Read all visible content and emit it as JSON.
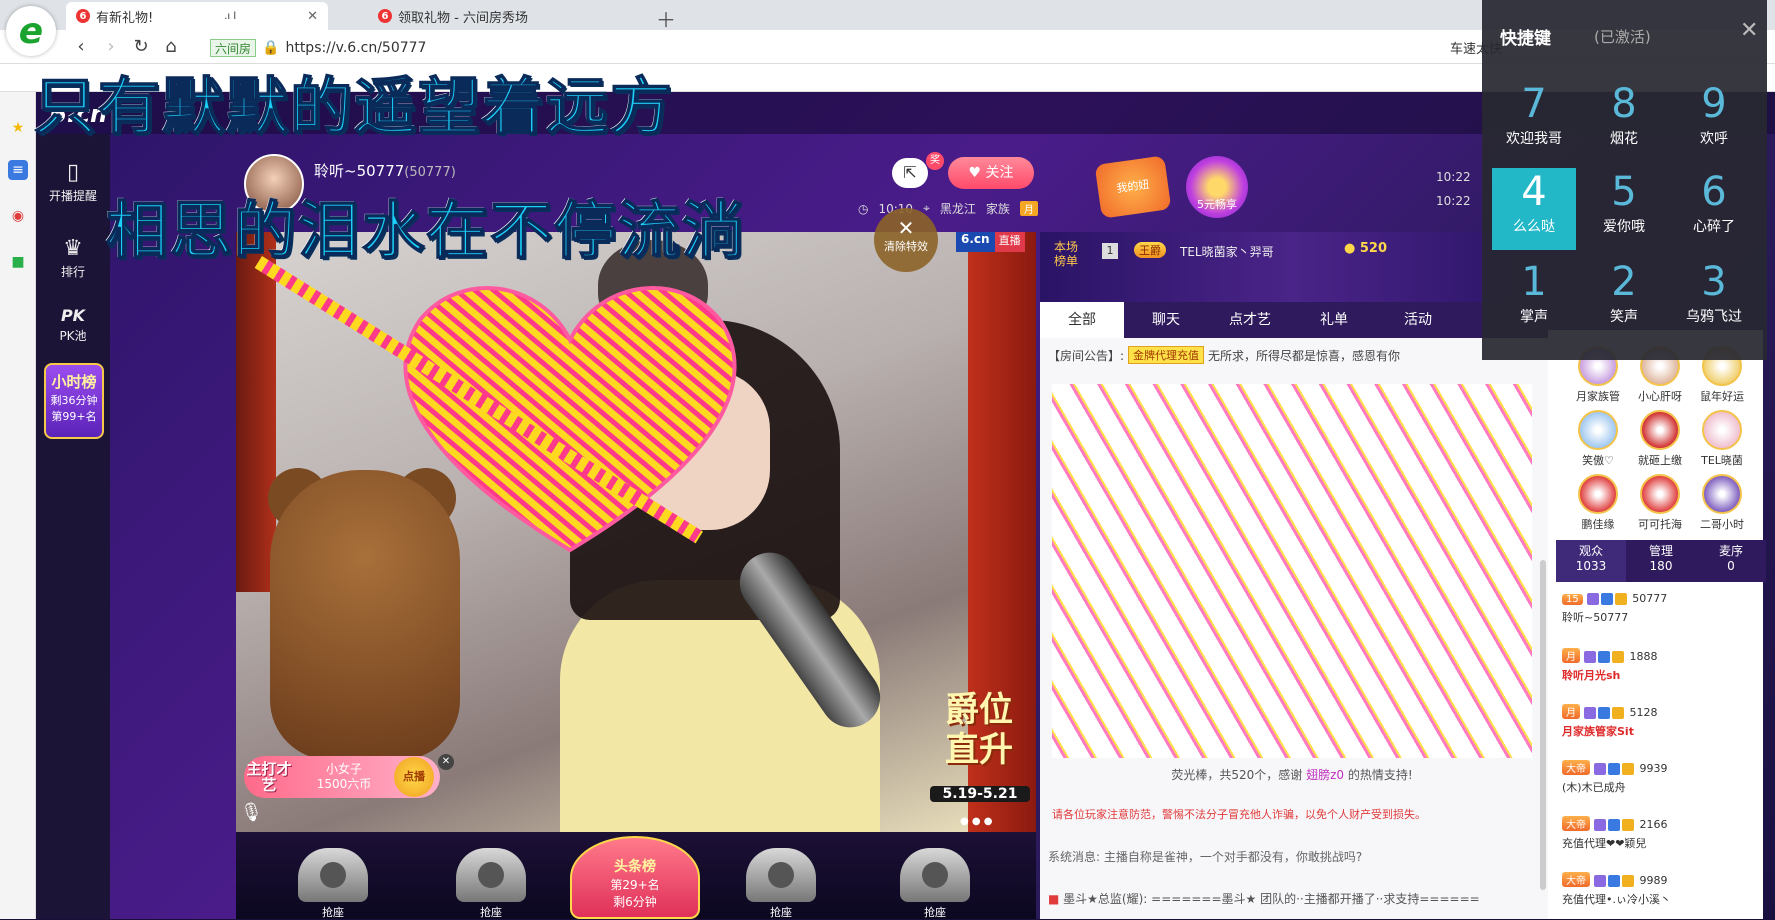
{
  "browser": {
    "tabs": [
      {
        "label": "有新礼物!",
        "status": ".ı l",
        "active": true
      },
      {
        "label": "领取礼物 - 六间房秀场",
        "active": false
      }
    ],
    "site_badge": "六间房",
    "url": "https://v.6.cn/50777",
    "tray_text": "车速太快"
  },
  "site": {
    "logo": "6.cn"
  },
  "left_rail": {
    "items": [
      {
        "label": "开播提醒",
        "icon": "phone-icon"
      },
      {
        "label": "排行",
        "icon": "crown-icon"
      },
      {
        "label": "PK池",
        "icon": "pk-icon"
      }
    ],
    "hourly": {
      "title": "小时榜",
      "remain": "剩36分钟",
      "rank": "第99+名"
    }
  },
  "room": {
    "anchor_name": "聆听~50777",
    "room_id": "(50777)",
    "share_count": "奖",
    "follow_label": "关注",
    "time": "10:10",
    "location": "黑龙江",
    "family_label": "家族",
    "family_badge": "月",
    "my_badge": "我的妞",
    "pay_badge": "5元畅享",
    "time_right_1": "10:22",
    "time_right_2": "10:22"
  },
  "lyrics": {
    "line1": "只有默默的遥望着远方",
    "line2": "相思的泪水在不停流淌"
  },
  "video": {
    "clear_label": "清除特效",
    "live_brand": "6.cn",
    "live_status": "直播",
    "promo_line1": "爵位",
    "promo_line2": "直升",
    "promo_date": "5.19-5.21",
    "feature_tag": "主打才艺",
    "feature_title": "小女子",
    "feature_price": "1500六币",
    "feature_btn": "点播"
  },
  "seats": [
    {
      "label": "抢座"
    },
    {
      "label": "抢座"
    },
    {
      "label": "抢座"
    },
    {
      "label": "抢座"
    }
  ],
  "rank_seat": {
    "title": "头条榜",
    "rank": "第29+名",
    "remain": "剩6分钟"
  },
  "chat": {
    "rank_label": "本场榜单",
    "rank_num": "1",
    "rank_tier": "王爵",
    "rank_user": "TEL晓菌家丶羿哥",
    "rank_coin": "520",
    "tabs": [
      "全部",
      "聊天",
      "点才艺",
      "礼单",
      "活动"
    ],
    "announce_prefix": "【房间公告】:",
    "announce_badge": "金牌代理充值",
    "announce_text": "无所求，所得尽都是惊喜，感恩有你",
    "gift_thanks_prefix": "荧光棒，共520个，感谢",
    "gift_thanks_user": "翅膀z0",
    "gift_thanks_suffix": "的热情支持!",
    "warning": "请各位玩家注意防范，警惕不法分子冒充他人诈骗，以免个人财产受到损失。",
    "system_prefix": "系统消息: 主播自称是雀神，一个对手都没有，你敢挑战吗?",
    "last_msg": "墨斗★总监(耀): =======墨斗★ 团队的··主播都开播了··求支持======"
  },
  "fans": [
    {
      "name": "月家族管",
      "color": "#c8a0e0"
    },
    {
      "name": "小心肝呀",
      "color": "#e0b8a0"
    },
    {
      "name": "鼠年好运",
      "color": "#f0d070"
    },
    {
      "name": "笑傲♡",
      "color": "#a0c8f0"
    },
    {
      "name": "就砸上缴",
      "color": "#d03030"
    },
    {
      "name": "TEL晓菌",
      "color": "#f0c0d0"
    },
    {
      "name": "鹏佳缘",
      "color": "#e04040"
    },
    {
      "name": "可可托海",
      "color": "#e04040"
    },
    {
      "name": "二哥小时",
      "color": "#8060c0"
    }
  ],
  "audience_tabs": [
    {
      "label": "观众",
      "count": "1033"
    },
    {
      "label": "管理",
      "count": "180"
    },
    {
      "label": "麦序",
      "count": "0"
    }
  ],
  "audience": [
    {
      "lv": "15",
      "id": "50777",
      "name": "聆听~50777",
      "red": false
    },
    {
      "lv": "月",
      "id": "1888",
      "name": "聆听月光sh",
      "red": true
    },
    {
      "lv": "月",
      "id": "5128",
      "name": "月家族管家Sit",
      "red": true
    },
    {
      "lv": "大帝",
      "id": "9939",
      "name": "(木)木已成舟",
      "red": false
    },
    {
      "lv": "大帝",
      "id": "2166",
      "name": "充值代理❤❤颖兒",
      "red": false
    },
    {
      "lv": "大帝",
      "id": "9989",
      "name": "充值代理•.ぃ冷小溪丶",
      "red": false
    }
  ],
  "shortcut": {
    "title": "快捷键",
    "status": "(已激活)",
    "keys": [
      {
        "num": "7",
        "label": "欢迎我哥"
      },
      {
        "num": "8",
        "label": "烟花"
      },
      {
        "num": "9",
        "label": "欢呼"
      },
      {
        "num": "4",
        "label": "么么哒",
        "selected": true
      },
      {
        "num": "5",
        "label": "爱你哦"
      },
      {
        "num": "6",
        "label": "心碎了"
      },
      {
        "num": "1",
        "label": "掌声"
      },
      {
        "num": "2",
        "label": "笑声"
      },
      {
        "num": "3",
        "label": "乌鸦飞过"
      }
    ]
  }
}
